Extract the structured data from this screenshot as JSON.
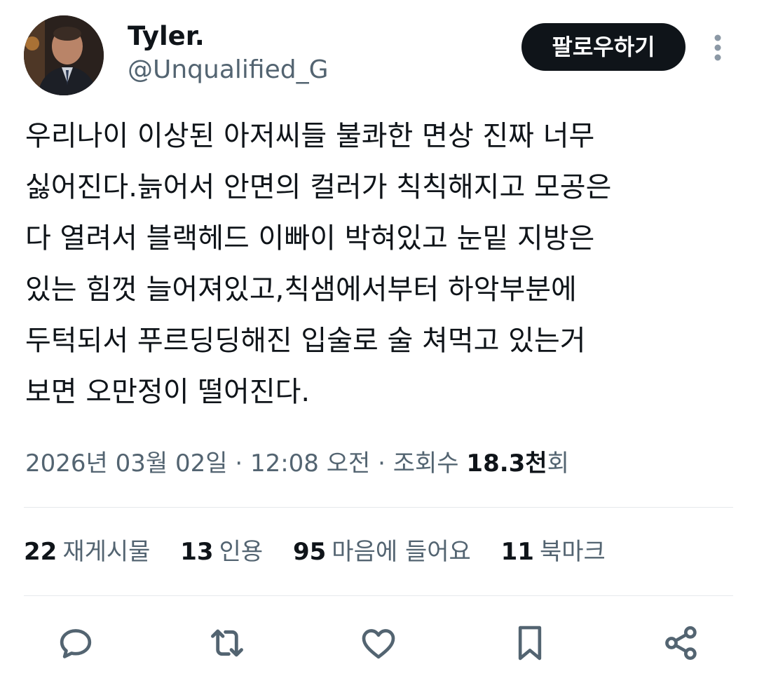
{
  "author": {
    "display_name": "Tyler.",
    "handle": "@Unqualified_G"
  },
  "follow_button": {
    "label": "팔로우하기"
  },
  "tweet": {
    "lines": [
      "우리나이 이상된 아저씨들 불콰한 면상 진짜 너무",
      "싫어진다.늙어서 안면의 컬러가 칙칙해지고 모공은",
      "다 열려서 블랙헤드 이빠이 박혀있고 눈밑 지방은",
      "있는 힘껏 늘어져있고,칙샘에서부터 하악부분에",
      "두턱되서 푸르딩딩해진 입술로 술 쳐먹고 있는거",
      "보면 오만정이 떨어진다."
    ]
  },
  "meta": {
    "date": "2026년 03월 02일",
    "separator": " · ",
    "time": "12:08 오전",
    "views_label": "조회수 ",
    "views_count": "18.3천",
    "views_suffix": "회"
  },
  "stats": {
    "retweets": {
      "count": "22",
      "label": "재게시물"
    },
    "quotes": {
      "count": "13",
      "label": "인용"
    },
    "likes": {
      "count": "95",
      "label": "마음에 들어요"
    },
    "bookmarks": {
      "count": "11",
      "label": "북마크"
    }
  },
  "icons": {
    "more": "more-vertical-icon",
    "reply": "reply-icon",
    "retweet": "retweet-icon",
    "like": "heart-icon",
    "bookmark": "bookmark-icon",
    "share": "share-icon"
  },
  "colors": {
    "text_primary": "#0f1419",
    "text_secondary": "#536471",
    "follow_bg": "#0f1419",
    "divider": "#e6e9ec",
    "icon": "#536471"
  }
}
